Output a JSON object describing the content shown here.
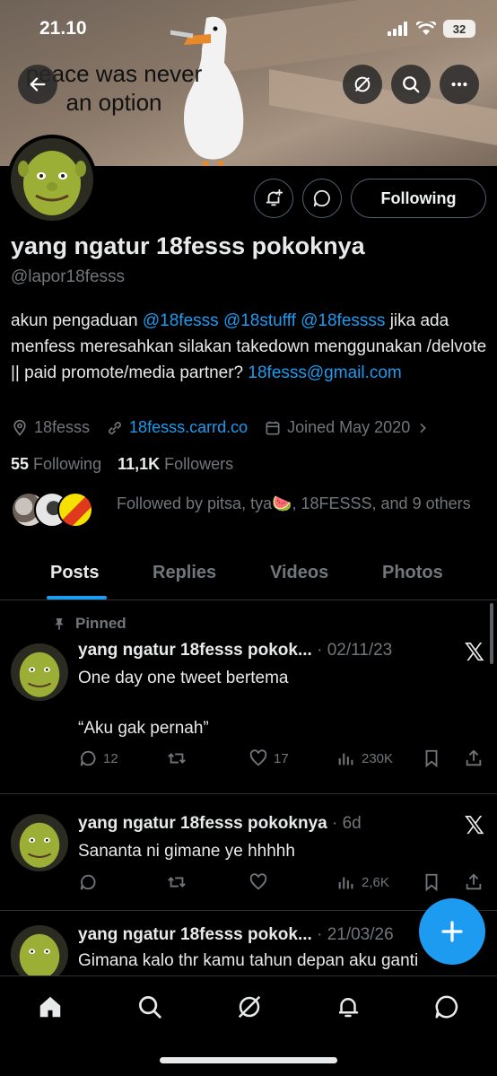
{
  "status_bar": {
    "time": "21.10",
    "battery": "32"
  },
  "banner": {
    "caption": "peace was never an option"
  },
  "profile": {
    "name": "yang ngatur 18fesss pokoknya",
    "handle": "@lapor18fesss",
    "following_button": "Following",
    "bio_prefix": "akun pengaduan ",
    "bio_mention_1": "@18fesss",
    "bio_mention_2": "@18stufff",
    "bio_mention_3": "@18fessss",
    "bio_rest": " jika ada menfess meresahkan silakan takedown menggunakan /delvote || paid promote/media partner? ",
    "bio_email": "18fesss@gmail.com",
    "location": "18fesss",
    "website": "18fesss.carrd.co",
    "joined": "Joined May 2020",
    "following_count": "55",
    "following_label": "Following",
    "followers_count": "11,1K",
    "followers_label": "Followers",
    "followed_by": "Followed by pitsa, tya🍉, 18FESSS, and 9 others"
  },
  "tabs": [
    "Posts",
    "Replies",
    "Videos",
    "Photos"
  ],
  "pinned_label": "Pinned",
  "posts": [
    {
      "name": "yang ngatur 18fesss pokok...",
      "date": " · 02/11/23",
      "text": "One day one tweet bertema\n\n“Aku gak pernah”",
      "replies": "12",
      "retweets": "",
      "likes": "17",
      "views": "230K"
    },
    {
      "name": "yang ngatur 18fesss pokoknya",
      "date": " · 6d",
      "text": "Sananta ni gimane ye hhhhh",
      "replies": "",
      "retweets": "",
      "likes": "",
      "views": "2,6K"
    },
    {
      "name": "yang ngatur 18fesss pokok...",
      "date": " · 21/03/26",
      "text": "Gimana kalo thr kamu tahun depan aku ganti"
    }
  ],
  "colors": {
    "accent": "#1d9bf0",
    "muted": "#71767b",
    "text": "#e7e9ea",
    "background": "#000000"
  }
}
